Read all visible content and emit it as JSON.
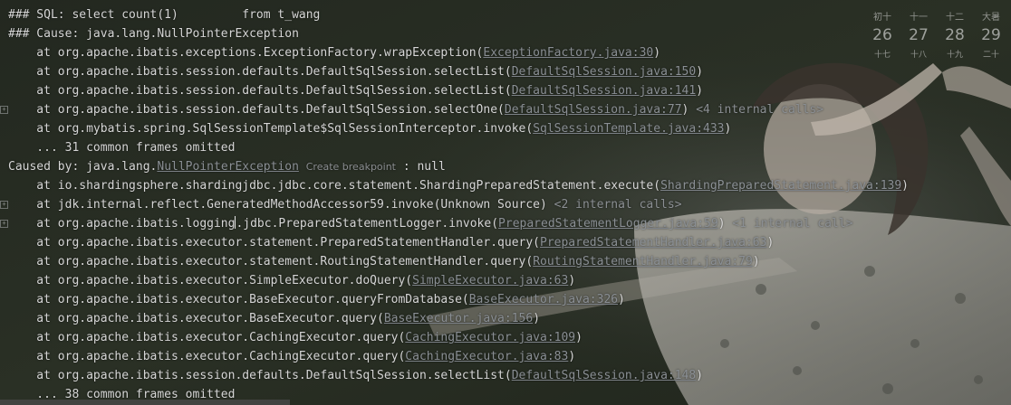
{
  "console": {
    "lines": [
      {
        "parts": [
          {
            "t": "### SQL: select count(1)         from t_wang"
          }
        ]
      },
      {
        "parts": [
          {
            "t": "### Cause: java.lang.NullPointerException"
          }
        ]
      },
      {
        "parts": [
          {
            "t": "    at org.apache.ibatis.exceptions.ExceptionFactory.wrapException("
          },
          {
            "t": "ExceptionFactory.java:30",
            "c": "link"
          },
          {
            "t": ")"
          }
        ]
      },
      {
        "parts": [
          {
            "t": "    at org.apache.ibatis.session.defaults.DefaultSqlSession.selectList("
          },
          {
            "t": "DefaultSqlSession.java:150",
            "c": "link"
          },
          {
            "t": ")"
          }
        ]
      },
      {
        "parts": [
          {
            "t": "    at org.apache.ibatis.session.defaults.DefaultSqlSession.selectList("
          },
          {
            "t": "DefaultSqlSession.java:141",
            "c": "link"
          },
          {
            "t": ")"
          }
        ]
      },
      {
        "gutter": true,
        "parts": [
          {
            "t": "    at org.apache.ibatis.session.defaults.DefaultSqlSession.selectOne("
          },
          {
            "t": "DefaultSqlSession.java:77",
            "c": "link"
          },
          {
            "t": ") "
          },
          {
            "t": "<4 internal calls>",
            "c": "grey"
          }
        ]
      },
      {
        "parts": [
          {
            "t": "    at org.mybatis.spring.SqlSessionTemplate$SqlSessionInterceptor.invoke("
          },
          {
            "t": "SqlSessionTemplate.java:433",
            "c": "link"
          },
          {
            "t": ")"
          }
        ]
      },
      {
        "parts": [
          {
            "t": "    ... 31 common frames omitted"
          }
        ]
      },
      {
        "parts": [
          {
            "t": "Caused by: java.lang."
          },
          {
            "t": "NullPointerException",
            "c": "link"
          },
          {
            "t": " "
          },
          {
            "t": "Create breakpoint",
            "c": "hint"
          },
          {
            "t": " : null"
          }
        ]
      },
      {
        "parts": [
          {
            "t": "    at io.shardingsphere.shardingjdbc.jdbc.core.statement.ShardingPreparedStatement.execute("
          },
          {
            "t": "ShardingPreparedStatement.java:139",
            "c": "link"
          },
          {
            "t": ")"
          }
        ]
      },
      {
        "gutter": true,
        "parts": [
          {
            "t": "    at jdk.internal.reflect.GeneratedMethodAccessor59.invoke(Unknown Source) "
          },
          {
            "t": "<2 internal calls>",
            "c": "grey"
          }
        ]
      },
      {
        "gutter": true,
        "parts": [
          {
            "t": "    at org.apache.ibatis.logging"
          },
          {
            "t": "",
            "c": "cursor"
          },
          {
            "t": ".jdbc.PreparedStatementLogger.invoke("
          },
          {
            "t": "PreparedStatementLogger.java:59",
            "c": "link"
          },
          {
            "t": ") "
          },
          {
            "t": "<1 internal call>",
            "c": "grey"
          }
        ]
      },
      {
        "parts": [
          {
            "t": "    at org.apache.ibatis.executor.statement.PreparedStatementHandler.query("
          },
          {
            "t": "PreparedStatementHandler.java:63",
            "c": "link"
          },
          {
            "t": ")"
          }
        ]
      },
      {
        "parts": [
          {
            "t": "    at org.apache.ibatis.executor.statement.RoutingStatementHandler.query("
          },
          {
            "t": "RoutingStatementHandler.java:79",
            "c": "link"
          },
          {
            "t": ")"
          }
        ]
      },
      {
        "parts": [
          {
            "t": "    at org.apache.ibatis.executor.SimpleExecutor.doQuery("
          },
          {
            "t": "SimpleExecutor.java:63",
            "c": "link"
          },
          {
            "t": ")"
          }
        ]
      },
      {
        "parts": [
          {
            "t": "    at org.apache.ibatis.executor.BaseExecutor.queryFromDatabase("
          },
          {
            "t": "BaseExecutor.java:326",
            "c": "link"
          },
          {
            "t": ")"
          }
        ]
      },
      {
        "parts": [
          {
            "t": "    at org.apache.ibatis.executor.BaseExecutor.query("
          },
          {
            "t": "BaseExecutor.java:156",
            "c": "link"
          },
          {
            "t": ")"
          }
        ]
      },
      {
        "parts": [
          {
            "t": "    at org.apache.ibatis.executor.CachingExecutor.query("
          },
          {
            "t": "CachingExecutor.java:109",
            "c": "link"
          },
          {
            "t": ")"
          }
        ]
      },
      {
        "parts": [
          {
            "t": "    at org.apache.ibatis.executor.CachingExecutor.query("
          },
          {
            "t": "CachingExecutor.java:83",
            "c": "link"
          },
          {
            "t": ")"
          }
        ]
      },
      {
        "parts": [
          {
            "t": "    at org.apache.ibatis.session.defaults.DefaultSqlSession.selectList("
          },
          {
            "t": "DefaultSqlSession.java:148",
            "c": "link"
          },
          {
            "t": ")"
          }
        ]
      },
      {
        "parts": [
          {
            "t": "    ... 38 common frames omitted"
          }
        ]
      }
    ],
    "gutter_glyph": "+"
  },
  "calendar": {
    "top": [
      "初十",
      "十一",
      "十二",
      "大暑"
    ],
    "days": [
      "26",
      "27",
      "28",
      "29"
    ],
    "sub": [
      "十七",
      "十八",
      "十九",
      "二十"
    ]
  },
  "colors": {
    "text": "#d6d6d6",
    "link": "#8a8f94",
    "hint": "#8b8f93",
    "background": "#262a23"
  }
}
